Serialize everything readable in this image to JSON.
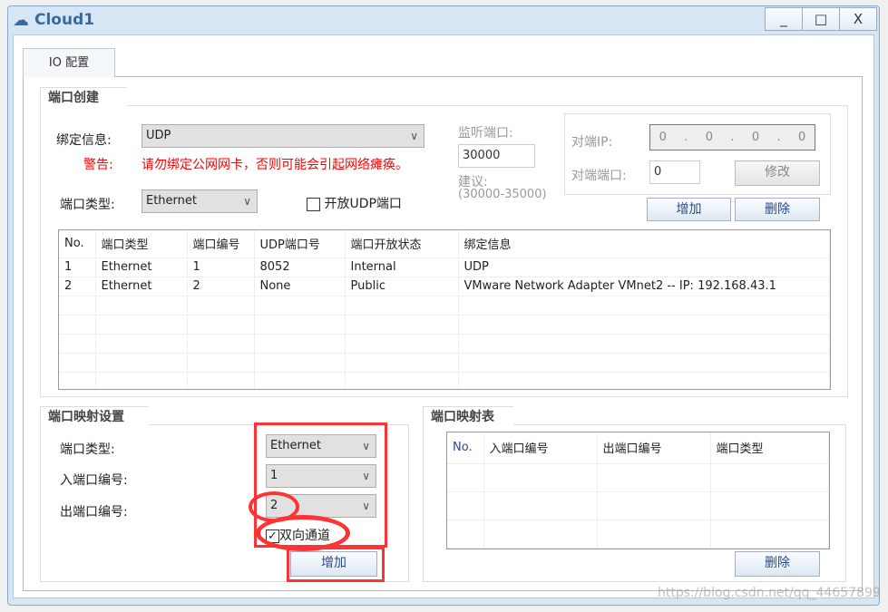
{
  "window": {
    "title": "Cloud1",
    "minimize": "_",
    "maximize": "□",
    "close": "X"
  },
  "tab": "IO 配置",
  "port_create": {
    "title": "端口创建",
    "bind_label": "绑定信息:",
    "bind_value": "UDP",
    "warn_label": "警告:",
    "warn_text": "请勿绑定公网网卡，否则可能会引起网络瘫痪。",
    "type_label": "端口类型:",
    "type_value": "Ethernet",
    "open_udp_label": "开放UDP端口",
    "open_udp_checked": false,
    "listen_label": "监听端口:",
    "listen_value": "30000",
    "suggest_label": "建议:",
    "suggest_range": "(30000-35000)",
    "peer_ip_label": "对端IP:",
    "peer_ip": [
      "0",
      "0",
      "0",
      "0"
    ],
    "peer_port_label": "对端端口:",
    "peer_port": "0",
    "modify": "修改",
    "add": "增加",
    "delete": "删除",
    "table": {
      "headers": [
        "No.",
        "端口类型",
        "端口编号",
        "UDP端口号",
        "端口开放状态",
        "绑定信息"
      ],
      "rows": [
        [
          "1",
          "Ethernet",
          "1",
          "8052",
          "Internal",
          "UDP"
        ],
        [
          "2",
          "Ethernet",
          "2",
          "None",
          "Public",
          "VMware Network Adapter VMnet2 -- IP: 192.168.43.1"
        ]
      ]
    }
  },
  "mapping_settings": {
    "title": "端口映射设置",
    "type_label": "端口类型:",
    "type_value": "Ethernet",
    "in_label": "入端口编号:",
    "in_value": "1",
    "out_label": "出端口编号:",
    "out_value": "2",
    "bidir_label": "双向通道",
    "bidir_checked": true,
    "add": "增加"
  },
  "mapping_table": {
    "title": "端口映射表",
    "headers": [
      "No.",
      "入端口编号",
      "出端口编号",
      "端口类型"
    ],
    "delete": "删除"
  },
  "watermark": "https://blog.csdn.net/qq_44657899",
  "colors": {
    "annotation": "#ff3333",
    "warning": "#ff0000",
    "title": "#3a6a9a"
  }
}
